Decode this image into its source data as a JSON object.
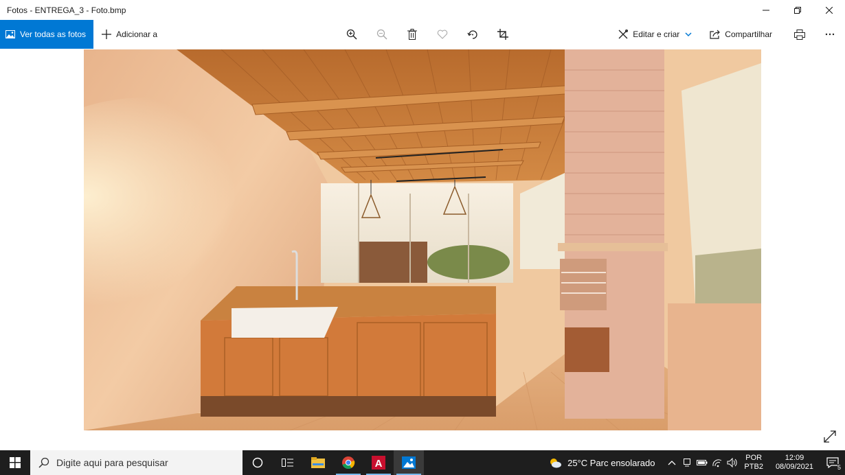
{
  "window": {
    "title": "Fotos - ENTREGA_3 - Foto.bmp"
  },
  "toolbar": {
    "see_all_label": "Ver todas as fotos",
    "add_label": "Adicionar a",
    "edit_create_label": "Editar e criar",
    "share_label": "Compartilhar"
  },
  "photo": {
    "description_icon": "rendered-gourmet-kitchen-image"
  },
  "taskbar": {
    "search_placeholder": "Digite aqui para pesquisar",
    "apps": [
      "cortana-icon",
      "task-view-icon",
      "file-explorer-icon",
      "chrome-icon",
      "autocad-icon",
      "photos-icon"
    ],
    "weather_text": "25°C  Parc ensolarado",
    "lang_line1": "POR",
    "lang_line2": "PTB2",
    "time": "12:09",
    "date": "08/09/2021",
    "notification_count": "5"
  },
  "colors": {
    "accent": "#0078d4",
    "taskbar_bg": "#1e1e1e"
  }
}
